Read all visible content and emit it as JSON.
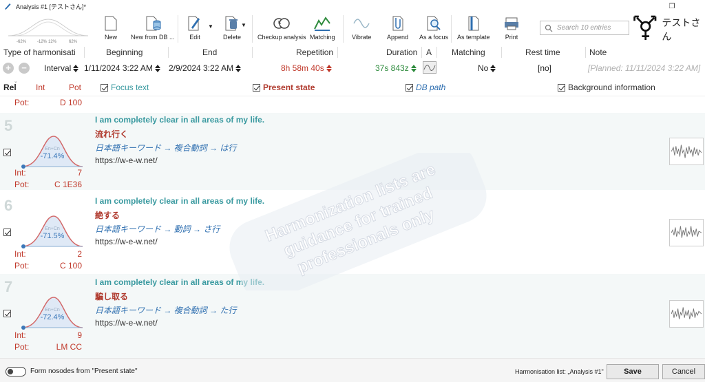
{
  "window": {
    "title": "Analysis #1 [テストさん]*"
  },
  "toolbar": {
    "curve_labels": [
      "-62%",
      "-12%",
      "12%",
      "62%"
    ],
    "buttons": [
      {
        "label": "New",
        "icon": "new-document-icon"
      },
      {
        "label": "New from DB ...",
        "icon": "new-from-db-icon"
      },
      {
        "label": "Edit",
        "icon": "edit-pencil-icon"
      },
      {
        "label": "Delete",
        "icon": "delete-icon"
      },
      {
        "label": "Checkup analysis",
        "icon": "checkup-analysis-icon"
      },
      {
        "label": "Matching",
        "icon": "matching-icon"
      },
      {
        "label": "Vibrate",
        "icon": "vibrate-wave-icon"
      },
      {
        "label": "Append",
        "icon": "append-clip-icon"
      },
      {
        "label": "As a focus",
        "icon": "focus-magnifier-icon"
      },
      {
        "label": "As template",
        "icon": "template-icon"
      },
      {
        "label": "Print",
        "icon": "print-icon"
      }
    ],
    "search_placeholder": "Search 10 entries",
    "user_name": "テストさん"
  },
  "columns": {
    "type": "Type of harmonisati",
    "beginning": "Beginning",
    "end": "End",
    "repetition": "Repetition",
    "duration": "Duration",
    "a": "A",
    "matching": "Matching",
    "rest_time": "Rest time",
    "note": "Note"
  },
  "values": {
    "type": "Interval",
    "beginning": "1/11/2024 3:22 AM",
    "end": "2/9/2024 3:22 AM",
    "repetition": "8h 58m 40s",
    "duration": "37s 843z",
    "matching": "No",
    "rest_time": "[no]",
    "note": "[Planned: 11/11/2024 3:22 AM]"
  },
  "list_header": {
    "rel": "Rel",
    "int": "Int",
    "pot": "Pot",
    "focus_text": "Focus text",
    "present_state": "Present state",
    "db_path": "DB path",
    "background_info": "Background information"
  },
  "top_partial": {
    "pot_label": "Pot:",
    "pot_value": "D 100"
  },
  "entries": [
    {
      "num": "5",
      "percent": "-71.4%",
      "bell_label": "En+Cn",
      "int_label": "Int:",
      "int_value": "7",
      "pot_label": "Pot:",
      "pot_value": "C 1E36",
      "focus": "I am completely clear in all areas of my life.",
      "present": "流れ行く",
      "db_path": "日本語キーワード → 複合動詞 → は行",
      "url": "https://w-e-w.net/"
    },
    {
      "num": "6",
      "percent": "-71.5%",
      "bell_label": "En+Cn",
      "int_label": "Int:",
      "int_value": "2",
      "pot_label": "Pot:",
      "pot_value": "C 100",
      "focus": "I am completely clear in all areas of my life.",
      "present": "絶する",
      "db_path": "日本語キーワード → 動詞 → さ行",
      "url": "https://w-e-w.net/"
    },
    {
      "num": "7",
      "percent": "-72.4%",
      "bell_label": "En+Cn",
      "int_label": "Int:",
      "int_value": "9",
      "pot_label": "Pot:",
      "pot_value": "LM CC",
      "focus": "I am completely clear in all areas of my life.",
      "present": "騙し取る",
      "db_path": "日本語キーワード → 複合動詞 → た行",
      "url": "https://w-e-w.net/"
    }
  ],
  "watermark": {
    "line1": "Harmonization lists are",
    "line2": "guidance for trained",
    "line3": "professionals only"
  },
  "footer": {
    "toggle_label": "Form nosodes from \"Present state\"",
    "list_label": "Harmonisation list: „Analysis #1\"",
    "save": "Save",
    "cancel": "Cancel"
  },
  "colors": {
    "teal": "#3a9aa0",
    "red": "#c0392b",
    "blue": "#2f6fb0",
    "green": "#2e8b3d"
  }
}
